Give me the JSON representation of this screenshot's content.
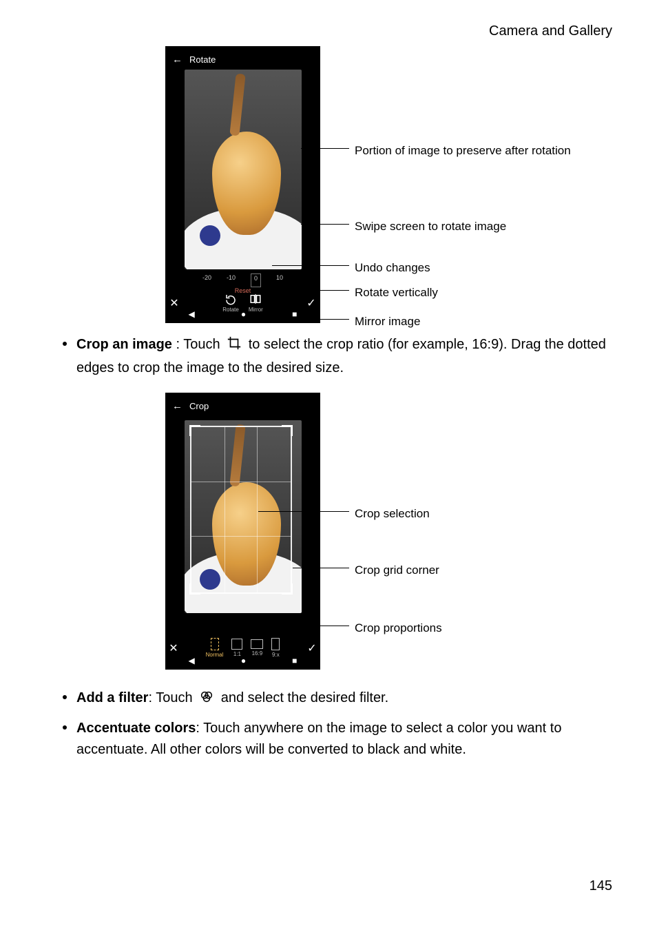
{
  "header": {
    "section": "Camera and Gallery"
  },
  "figure1": {
    "phone_title": "Rotate",
    "slider_marks": [
      "-20",
      "-10",
      "0",
      "10"
    ],
    "reset": "Reset",
    "tools": {
      "rotate": "Rotate",
      "mirror": "Mirror"
    },
    "callouts": {
      "preserve": "Portion of image to preserve after rotation",
      "swipe": "Swipe screen to rotate image",
      "undo": "Undo changes",
      "vertical": "Rotate vertically",
      "mirror": "Mirror image"
    }
  },
  "bullets": {
    "crop": {
      "title": "Crop an image",
      "body_before": " : Touch ",
      "body_after": " to select the crop ratio (for example, 16:9). Drag the dotted edges to crop the image to the desired size."
    },
    "filter": {
      "title": "Add a filter",
      "body_before": ": Touch ",
      "body_after": " and select the desired filter."
    },
    "accent": {
      "title": "Accentuate colors",
      "body": ": Touch anywhere on the image to select a color you want to accentuate. All other colors will be converted to black and white."
    }
  },
  "figure2": {
    "phone_title": "Crop",
    "tools": {
      "normal": "Normal",
      "one": "1:1",
      "sixteen": "16:9",
      "nine": "9:x"
    },
    "callouts": {
      "selection": "Crop selection",
      "corner": "Crop grid corner",
      "proportions": "Crop proportions"
    }
  },
  "page_number": "145"
}
